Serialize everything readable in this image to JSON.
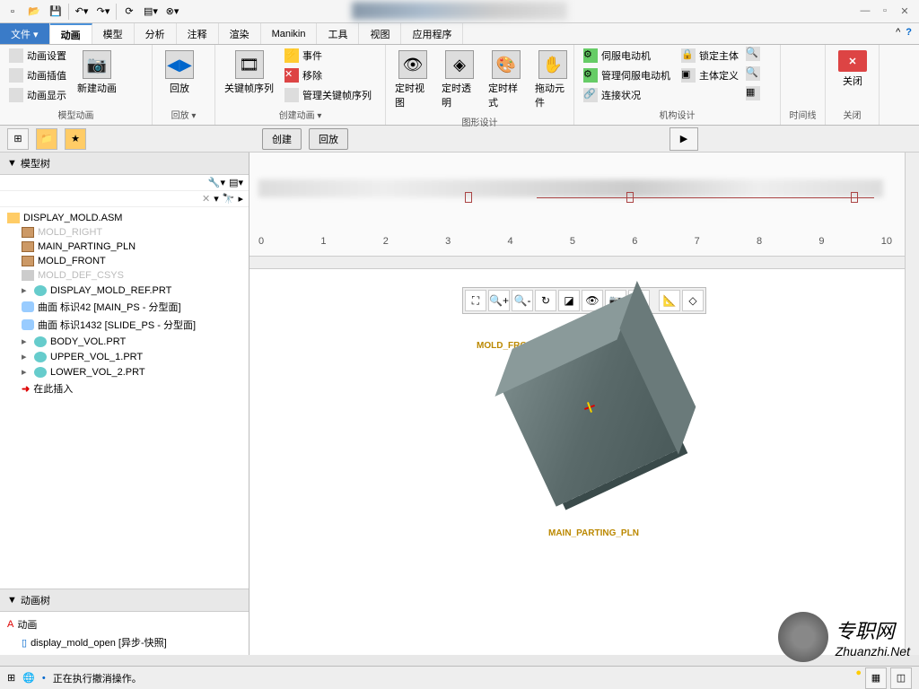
{
  "menubar": {
    "file": "文件 ▾",
    "tabs": [
      "动画",
      "模型",
      "分析",
      "注释",
      "渲染",
      "Manikin",
      "工具",
      "视图",
      "应用程序"
    ]
  },
  "ribbon": {
    "anim_settings": "动画设置",
    "anim_interp": "动画插值",
    "anim_display": "动画显示",
    "new_anim": "新建动画",
    "playback": "回放",
    "keyframe_seq": "关键帧序列",
    "event": "事件",
    "remove": "移除",
    "manage_kfs": "管理关键帧序列",
    "timed_view": "定时视图",
    "timed_trans": "定时透明",
    "timed_style": "定时样式",
    "drag_comp": "拖动元件",
    "servo_motor": "伺服电动机",
    "manage_servo": "管理伺服电动机",
    "conn_status": "连接状况",
    "lock_body": "锁定主体",
    "body_def": "主体定义",
    "close": "关闭",
    "groups": {
      "model_anim": "模型动画",
      "playback": "回放 ▾",
      "create_anim": "创建动画 ▾",
      "graphic_design": "图形设计",
      "mech_design": "机构设计",
      "timeline": "时间线",
      "close": "关闭"
    }
  },
  "toolbar2": {
    "create": "创建",
    "playback": "回放"
  },
  "tree": {
    "model_tree": "模型树",
    "anim_tree": "动画树",
    "root": "DISPLAY_MOLD.ASM",
    "nodes": [
      {
        "label": "MOLD_RIGHT",
        "dim": true
      },
      {
        "label": "MAIN_PARTING_PLN"
      },
      {
        "label": "MOLD_FRONT"
      },
      {
        "label": "MOLD_DEF_CSYS",
        "dim": true
      },
      {
        "label": "DISPLAY_MOLD_REF.PRT",
        "exp": true
      },
      {
        "label": "曲面 标识42 [MAIN_PS - 分型面]"
      },
      {
        "label": "曲面 标识1432 [SLIDE_PS - 分型面]"
      },
      {
        "label": "BODY_VOL.PRT",
        "exp": true
      },
      {
        "label": "UPPER_VOL_1.PRT",
        "exp": true
      },
      {
        "label": "LOWER_VOL_2.PRT",
        "exp": true
      },
      {
        "label": "在此插入"
      }
    ],
    "anim_root": "动画",
    "anim_item": "display_mold_open [异步-快照]"
  },
  "ruler": [
    "0",
    "1",
    "2",
    "3",
    "4",
    "5",
    "6",
    "7",
    "8",
    "9",
    "10"
  ],
  "viewport": {
    "label1": "MOLD_FRONT",
    "label2": "MAIN_PARTING_PLN"
  },
  "status": {
    "msg": "正在执行撤消操作。"
  },
  "watermark": {
    "line1": "专职网",
    "line2": "Zhuanzhi.Net"
  }
}
